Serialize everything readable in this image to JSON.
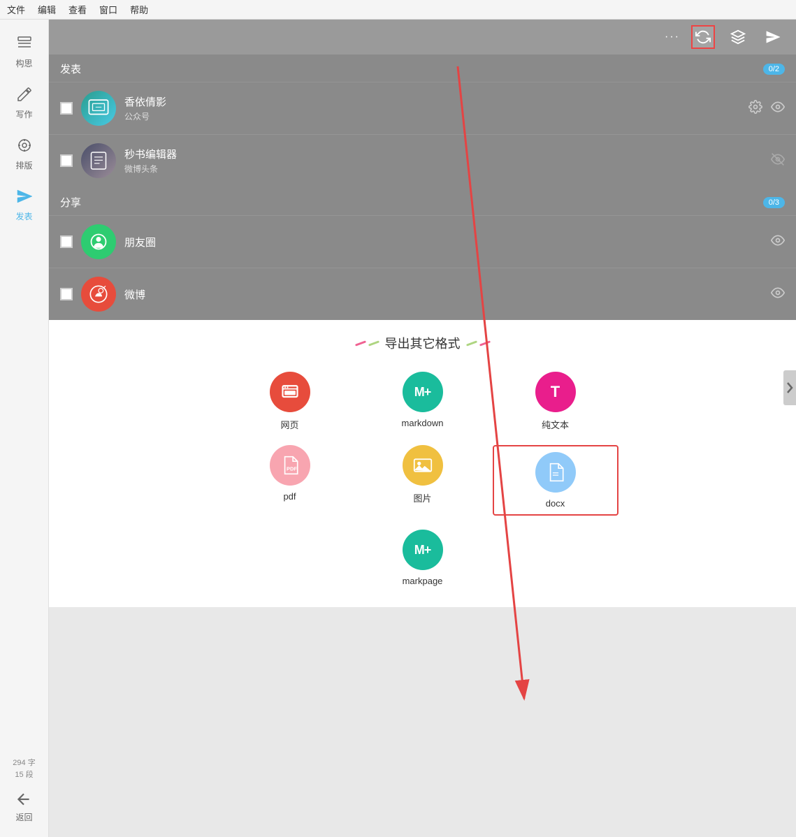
{
  "menu": {
    "items": [
      "文件",
      "编辑",
      "查看",
      "窗口",
      "帮助"
    ]
  },
  "sidebar": {
    "items": [
      {
        "id": "goushu",
        "label": "构思",
        "icon": "☰"
      },
      {
        "id": "xiezuo",
        "label": "写作",
        "icon": "✏"
      },
      {
        "id": "paiban",
        "label": "排版",
        "icon": "🎨"
      },
      {
        "id": "fabian",
        "label": "发表",
        "icon": "✈",
        "active": true
      }
    ],
    "word_count": "294 字",
    "para_count": "15 段",
    "return_label": "返回"
  },
  "toolbar": {
    "dots": "···",
    "refresh_icon": "⟳",
    "layers_icon": "⧉",
    "send_icon": "▶"
  },
  "publish_section": {
    "title": "发表",
    "badge": "0/2",
    "items": [
      {
        "name": "香依倩影",
        "sub": "公众号",
        "avatar_type": "xiangyi"
      },
      {
        "name": "秒书编辑器",
        "sub": "微博头条",
        "avatar_type": "weibo-toutiao"
      }
    ]
  },
  "share_section": {
    "title": "分享",
    "badge": "0/3",
    "items": [
      {
        "name": "朋友圈",
        "sub": "",
        "avatar_type": "pengyouquan"
      },
      {
        "name": "微博",
        "sub": "",
        "avatar_type": "weibo"
      }
    ]
  },
  "export_section": {
    "title": "导出其它格式",
    "items": [
      {
        "id": "webpage",
        "label": "网页",
        "color": "#e74c3c",
        "icon": "⊞"
      },
      {
        "id": "markdown",
        "label": "markdown",
        "color": "#1abc9c",
        "icon": "M+"
      },
      {
        "id": "plaintext",
        "label": "纯文本",
        "color": "#e91e8c",
        "icon": "T"
      },
      {
        "id": "pdf",
        "label": "pdf",
        "color": "#f8a5b0",
        "icon": "📄"
      },
      {
        "id": "image",
        "label": "图片",
        "color": "#f0c040",
        "icon": "🖼"
      },
      {
        "id": "docx",
        "label": "docx",
        "color": "#90caf9",
        "icon": "📋",
        "highlighted": true
      }
    ],
    "extra_items": [
      {
        "id": "markpage",
        "label": "markpage",
        "color": "#1abc9c",
        "icon": "M+"
      }
    ]
  },
  "colors": {
    "active_blue": "#4db6e8",
    "red_arrow": "#e44444"
  }
}
